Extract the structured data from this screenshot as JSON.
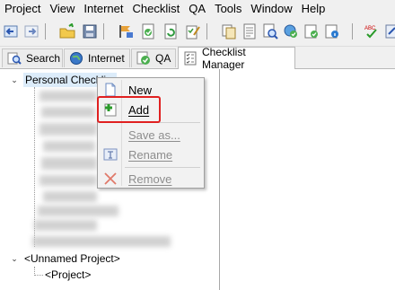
{
  "menubar": [
    "Project",
    "View",
    "Internet",
    "Checklist",
    "QA",
    "Tools",
    "Window",
    "Help"
  ],
  "tabs": [
    {
      "label": "Search",
      "icon": "search-icon"
    },
    {
      "label": "Internet",
      "icon": "internet-icon"
    },
    {
      "label": "QA",
      "icon": "qa-icon"
    },
    {
      "label": "Checklist Manager",
      "icon": "checklist-icon",
      "active": true
    }
  ],
  "tree": {
    "root_label": "Personal Checkli...",
    "project_label": "<Unnamed Project>",
    "project_child": "<Project>"
  },
  "context_menu": {
    "new": "New",
    "add": "Add",
    "save_as": "Save as...",
    "rename": "Rename",
    "remove": "Remove"
  },
  "colors": {
    "highlight": "#e02020"
  }
}
